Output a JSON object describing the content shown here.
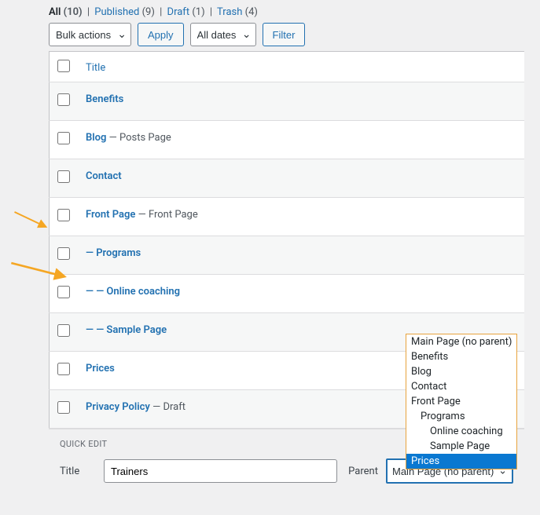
{
  "filters": {
    "all_label": "All",
    "all_count": "(10)",
    "published_label": "Published",
    "published_count": "(9)",
    "draft_label": "Draft",
    "draft_count": "(1)",
    "trash_label": "Trash",
    "trash_count": "(4)"
  },
  "tablenav": {
    "bulk_label": "Bulk actions",
    "apply_label": "Apply",
    "dates_label": "All dates",
    "filter_label": "Filter"
  },
  "columns": {
    "title": "Title"
  },
  "rows": [
    {
      "prefix": "",
      "title": "Benefits",
      "state": ""
    },
    {
      "prefix": "",
      "title": "Blog",
      "state": " — Posts Page"
    },
    {
      "prefix": "",
      "title": "Contact",
      "state": ""
    },
    {
      "prefix": "",
      "title": "Front Page",
      "state": " — Front Page"
    },
    {
      "prefix": "— ",
      "title": "Programs",
      "state": ""
    },
    {
      "prefix": "— — ",
      "title": "Online coaching",
      "state": ""
    },
    {
      "prefix": "— — ",
      "title": "Sample Page",
      "state": ""
    },
    {
      "prefix": "",
      "title": "Prices",
      "state": ""
    },
    {
      "prefix": "",
      "title": "Privacy Policy",
      "state": " — Draft"
    }
  ],
  "quickedit": {
    "heading": "QUICK EDIT",
    "title_label": "Title",
    "title_value": "Trainers",
    "parent_label": "Parent",
    "parent_selected": "Main Page (no parent)"
  },
  "parent_options": [
    {
      "label": "Main Page (no parent)",
      "indent": 0
    },
    {
      "label": "Benefits",
      "indent": 0
    },
    {
      "label": "Blog",
      "indent": 0
    },
    {
      "label": "Contact",
      "indent": 0
    },
    {
      "label": "Front Page",
      "indent": 0
    },
    {
      "label": "Programs",
      "indent": 1
    },
    {
      "label": "Online coaching",
      "indent": 2
    },
    {
      "label": "Sample Page",
      "indent": 2
    },
    {
      "label": "Prices",
      "indent": 0,
      "selected": true
    }
  ]
}
